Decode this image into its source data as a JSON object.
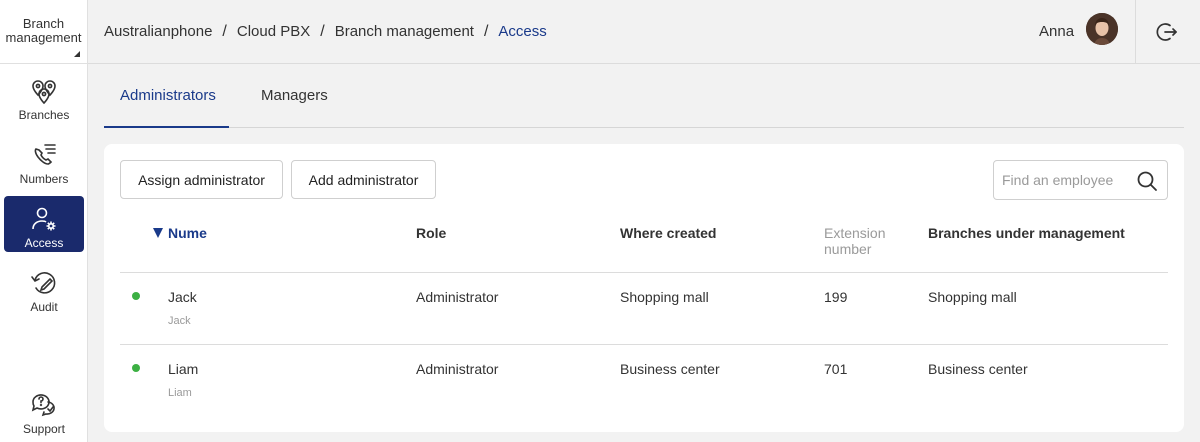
{
  "sidebar": {
    "header": {
      "line1": "Branch",
      "line2": "management"
    },
    "items": [
      {
        "label": "Branches",
        "icon": "branches-icon"
      },
      {
        "label": "Numbers",
        "icon": "numbers-icon"
      },
      {
        "label": "Access",
        "icon": "access-icon",
        "active": true
      },
      {
        "label": "Audit",
        "icon": "audit-icon"
      },
      {
        "label": "Support",
        "icon": "support-icon"
      }
    ]
  },
  "breadcrumb": [
    "Australianphone",
    "Cloud PBX",
    "Branch management",
    "Access"
  ],
  "user": {
    "name": "Anna"
  },
  "tabs": [
    {
      "label": "Administrators",
      "active": true
    },
    {
      "label": "Managers"
    }
  ],
  "toolbar": {
    "assign_label": "Assign administrator",
    "add_label": "Add administrator",
    "search_placeholder": "Find an employee"
  },
  "table": {
    "columns": {
      "name": "Nume",
      "role": "Role",
      "where": "Where created",
      "ext_line1": "Extension",
      "ext_line2": "number",
      "branches": "Branches under management"
    },
    "rows": [
      {
        "name": "Jack",
        "sub": "Jack",
        "role": "Administrator",
        "where": "Shopping mall",
        "ext": "199",
        "branches": "Shopping mall",
        "status": "online"
      },
      {
        "name": "Liam",
        "sub": "Liam",
        "role": "Administrator",
        "where": "Business center",
        "ext": "701",
        "branches": "Business center",
        "status": "online"
      }
    ]
  },
  "colors": {
    "accent": "#1a2a6c",
    "link": "#1a3a8a",
    "online": "#3cb043"
  }
}
